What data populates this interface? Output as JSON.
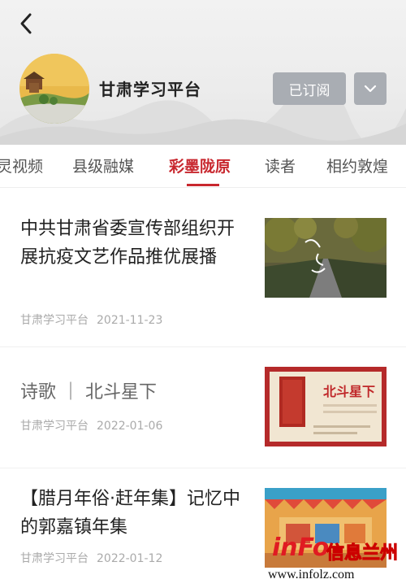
{
  "header": {
    "title": "甘肃学习平台",
    "subscribe_label": "已订阅",
    "back_icon": "chevron-left-icon",
    "dropdown_icon": "chevron-down-icon"
  },
  "tabs": [
    {
      "label": "灵视频",
      "active": false
    },
    {
      "label": "县级融媒",
      "active": false
    },
    {
      "label": "彩墨陇原",
      "active": true
    },
    {
      "label": "读者",
      "active": false
    },
    {
      "label": "相约敦煌",
      "active": false
    }
  ],
  "articles": [
    {
      "title": "中共甘肃省委宣传部组织开展抗疫文艺作品推优展播",
      "source": "甘肃学习平台",
      "date": "2021-11-23"
    },
    {
      "title": "诗歌 ｜ 北斗星下",
      "source": "甘肃学习平台",
      "date": "2022-01-06",
      "thumb_text": "北斗星下"
    },
    {
      "title": "【腊月年俗·赶年集】记忆中的郭嘉镇年集",
      "source": "甘肃学习平台",
      "date": "2022-01-12"
    }
  ],
  "watermark": {
    "logo": "inFo",
    "name": "信息兰州",
    "url": "www.infolz.com"
  },
  "colors": {
    "accent": "#c8272e",
    "button_gray": "#a9adb3"
  }
}
